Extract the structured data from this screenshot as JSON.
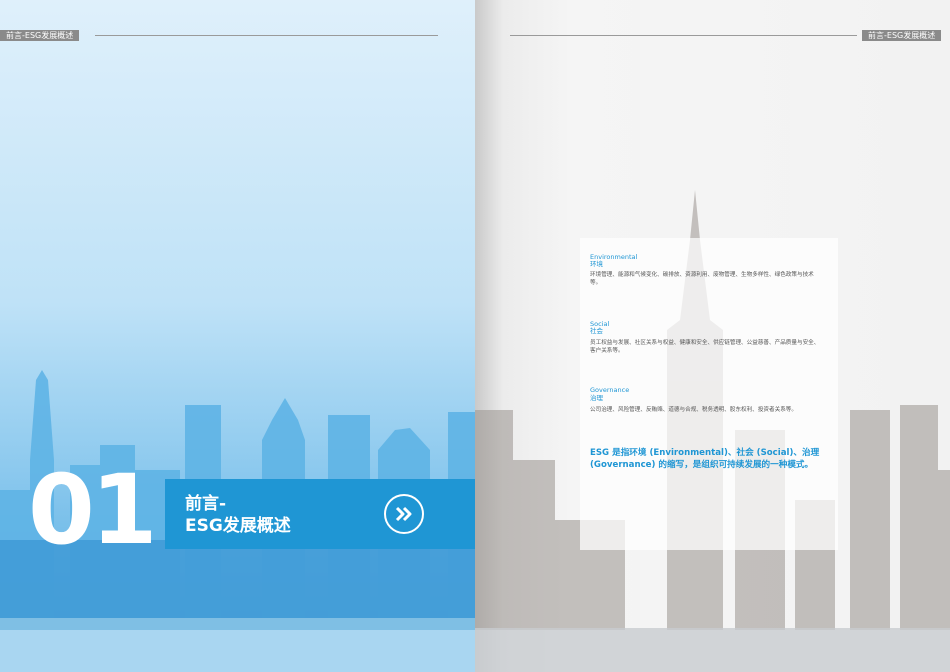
{
  "header": {
    "tag_left": "前言-ESG发展概述",
    "tag_right": "前言-ESG发展概述"
  },
  "chapter": {
    "number": "01",
    "title": "前言-\nESG发展概述",
    "nav_icon": "double-chevron-right-icon"
  },
  "sections": [
    {
      "en": "Environmental",
      "zh": "环境",
      "body": "环境管理、能源和气候变化、碳排放、资源利用、废物管理、生物多样性、绿色政策与技术等。"
    },
    {
      "en": "Social",
      "zh": "社会",
      "body": "员工权益与发展、社区关系与权益、健康和安全、供应链管理、公益慈善、产品质量与安全、客户关系等。"
    },
    {
      "en": "Governance",
      "zh": "治理",
      "body": "公司治理、风险管理、反贿赂、道德与合规、税务透明、股东权利、投资者关系等。"
    }
  ],
  "summary": "ESG 是指环境 (Environmental)、社会 (Social)、治理 (Governance) 的缩写，是组织可持续发展的一种模式。",
  "colors": {
    "accent": "#1f96d4",
    "tag": "#8a8a8a"
  }
}
